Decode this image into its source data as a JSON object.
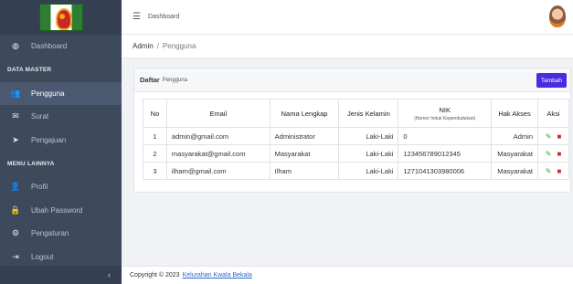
{
  "sidebar": {
    "items_top": [
      {
        "label": "Dashboard",
        "icon": "dashboard-icon",
        "glyph": "◍"
      }
    ],
    "section_master": "DATA MASTER",
    "items_master": [
      {
        "label": "Pengguna",
        "icon": "users-icon",
        "glyph": "👥",
        "active": true
      },
      {
        "label": "Surat",
        "icon": "mail-icon",
        "glyph": "✉"
      },
      {
        "label": "Pengajuan",
        "icon": "send-icon",
        "glyph": "➤"
      }
    ],
    "section_account": "MENU LAINNYA",
    "items_account": [
      {
        "label": "Profil",
        "icon": "user-gear-icon",
        "glyph": "👤"
      },
      {
        "label": "Ubah Password",
        "icon": "lock-icon",
        "glyph": "🔒"
      },
      {
        "label": "Pengaturan",
        "icon": "cogs-icon",
        "glyph": "⚙"
      },
      {
        "label": "Logout",
        "icon": "logout-icon",
        "glyph": "⇥"
      }
    ],
    "collapse_glyph": "‹"
  },
  "topbar": {
    "title": "Dashboard"
  },
  "breadcrumb": {
    "root": "Admin",
    "separator": "/",
    "current": "Pengguna"
  },
  "card": {
    "title": "Daftar",
    "subtitle": "Pengguna",
    "add_button": "Tambah"
  },
  "table": {
    "headers": {
      "no": "No",
      "email": "Email",
      "name": "Nama Lengkap",
      "gender": "Jenis Kelamin",
      "nik": "NIK",
      "nik_sub": "(Nomor Induk Kependudukan)",
      "role": "Hak Akses",
      "action": "Aksi"
    },
    "rows": [
      {
        "no": "1",
        "email": "admin@gmail.com",
        "name": "Administrator",
        "gender": "Laki-Laki",
        "nik": "0",
        "role": "Admin"
      },
      {
        "no": "2",
        "email": "masyarakat@gmail.com",
        "name": "Masyarakat",
        "gender": "Laki-Laki",
        "nik": "123456789012345",
        "role": "Masyarakat"
      },
      {
        "no": "3",
        "email": "ilham@gmail.com",
        "name": "Ilham",
        "gender": "Laki-Laki",
        "nik": "1271041303980006",
        "role": "Masyarakat"
      }
    ]
  },
  "footer": {
    "text": "Copyright © 2023",
    "link": "Kelurahan Kwala Bekala"
  },
  "colors": {
    "sidebar": "#3d4a5c",
    "accent": "#4b2be0",
    "edit": "#2e9e3e",
    "delete": "#d9232d"
  }
}
